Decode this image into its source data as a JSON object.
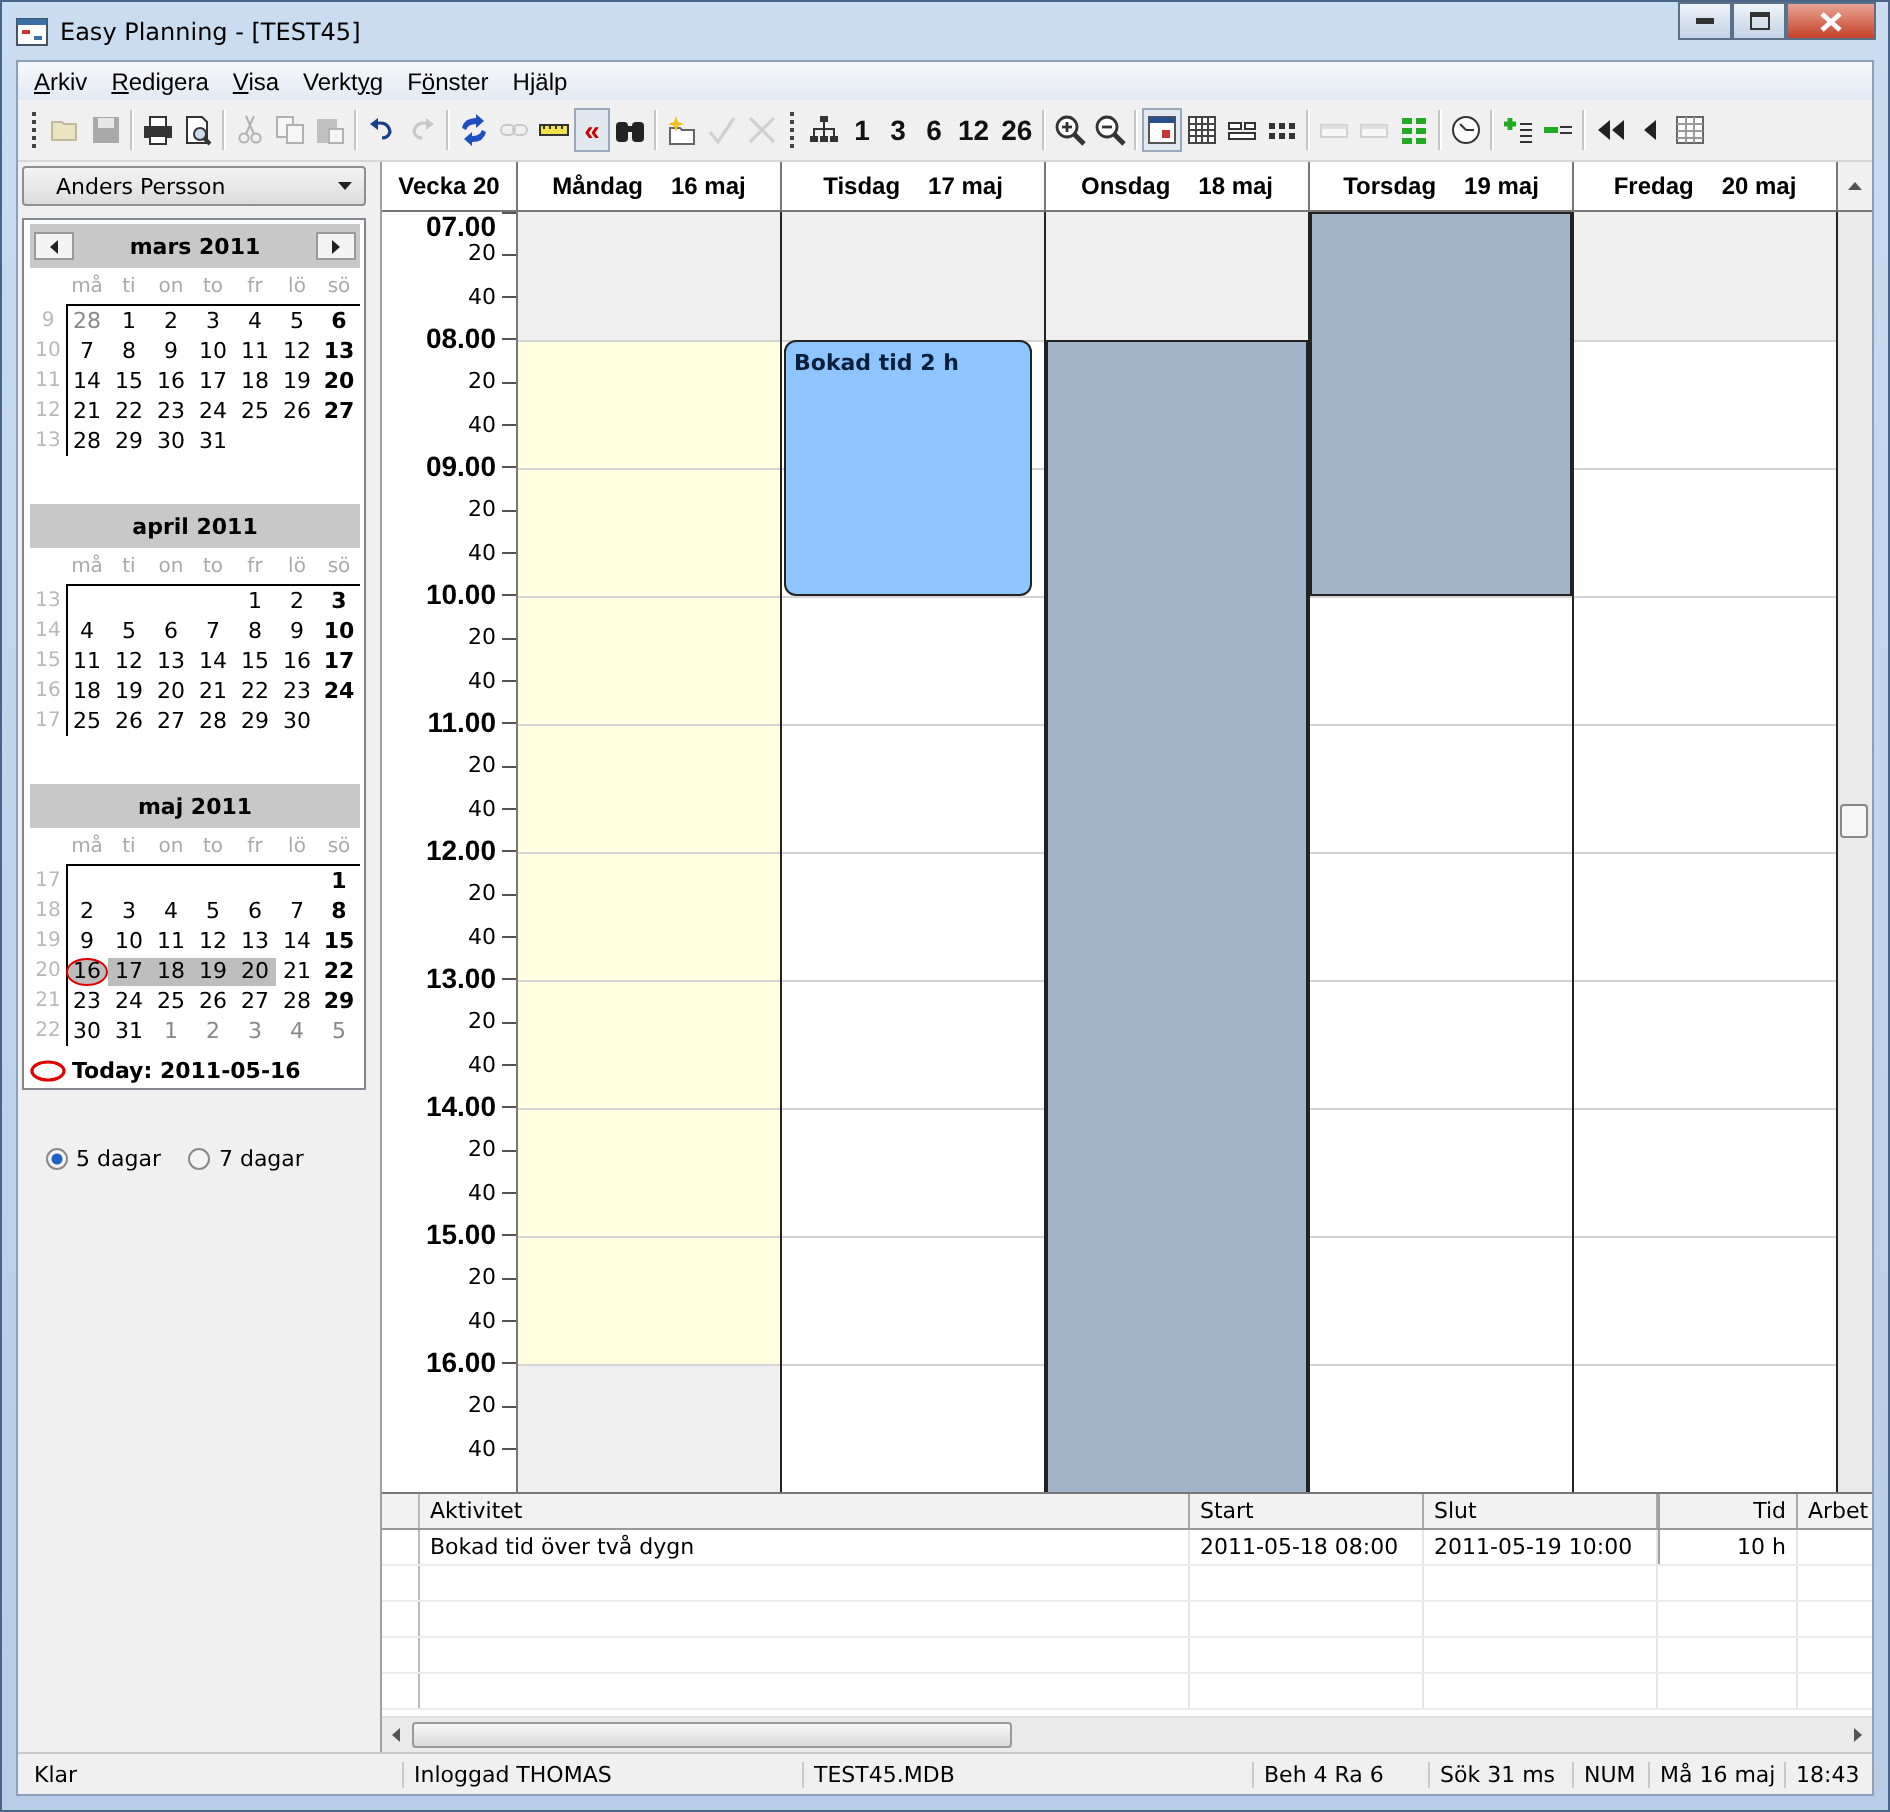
{
  "window": {
    "title": "Easy Planning - [TEST45]"
  },
  "menu": [
    {
      "key": "A",
      "post": "rkiv"
    },
    {
      "key": "R",
      "post": "edigera"
    },
    {
      "key": "V",
      "post": "isa"
    },
    {
      "pre": "Verkt",
      "key": "y",
      "post": "g"
    },
    {
      "pre": "F",
      "key": "ö",
      "post": "nster"
    },
    {
      "pre": "H",
      "key": "j",
      "post": "älp"
    }
  ],
  "toolbar": [
    {
      "kind": "grip"
    },
    {
      "kind": "icon",
      "disabled": true,
      "pressed": false
    },
    {
      "kind": "icon",
      "disabled": true,
      "pressed": false
    },
    {
      "kind": "separator"
    },
    {
      "kind": "icon",
      "disabled": false,
      "pressed": false
    },
    {
      "kind": "icon",
      "disabled": false,
      "pressed": false
    },
    {
      "kind": "separator"
    },
    {
      "kind": "icon",
      "disabled": true,
      "pressed": false
    },
    {
      "kind": "icon",
      "disabled": true,
      "pressed": false
    },
    {
      "kind": "icon",
      "disabled": true,
      "pressed": false
    },
    {
      "kind": "separator"
    },
    {
      "kind": "icon",
      "disabled": false,
      "pressed": false
    },
    {
      "kind": "icon",
      "disabled": true,
      "pressed": false
    },
    {
      "kind": "separator"
    },
    {
      "kind": "icon",
      "disabled": false,
      "pressed": false
    },
    {
      "kind": "icon",
      "disabled": true,
      "pressed": false
    },
    {
      "kind": "icon",
      "disabled": false,
      "pressed": false
    },
    {
      "kind": "text",
      "label": "«",
      "disabled": false,
      "pressed": true
    },
    {
      "kind": "icon",
      "disabled": false,
      "pressed": false
    },
    {
      "kind": "separator"
    },
    {
      "kind": "icon",
      "disabled": false,
      "pressed": false
    },
    {
      "kind": "icon",
      "disabled": true,
      "pressed": false
    },
    {
      "kind": "icon",
      "disabled": true,
      "pressed": false
    },
    {
      "kind": "grip"
    },
    {
      "kind": "icon",
      "disabled": false,
      "pressed": false
    },
    {
      "kind": "text",
      "label": "1",
      "disabled": false,
      "pressed": false
    },
    {
      "kind": "text",
      "label": "3",
      "disabled": false,
      "pressed": false
    },
    {
      "kind": "text",
      "label": "6",
      "disabled": false,
      "pressed": false
    },
    {
      "kind": "text",
      "label": "12",
      "disabled": false,
      "pressed": false
    },
    {
      "kind": "text",
      "label": "26",
      "disabled": false,
      "pressed": false
    },
    {
      "kind": "separator"
    },
    {
      "kind": "icon",
      "disabled": false,
      "pressed": false
    },
    {
      "kind": "icon",
      "disabled": false,
      "pressed": false
    },
    {
      "kind": "separator"
    },
    {
      "kind": "icon",
      "disabled": false,
      "pressed": true
    },
    {
      "kind": "icon",
      "disabled": false,
      "pressed": false
    },
    {
      "kind": "icon",
      "disabled": false,
      "pressed": false
    },
    {
      "kind": "icon",
      "disabled": false,
      "pressed": false
    },
    {
      "kind": "separator"
    },
    {
      "kind": "icon",
      "disabled": true,
      "pressed": false
    },
    {
      "kind": "icon",
      "disabled": true,
      "pressed": false
    },
    {
      "kind": "icon",
      "disabled": false,
      "pressed": false
    },
    {
      "kind": "separator"
    },
    {
      "kind": "icon",
      "disabled": false,
      "pressed": false
    },
    {
      "kind": "separator"
    },
    {
      "kind": "icon",
      "disabled": false,
      "pressed": false
    },
    {
      "kind": "icon",
      "disabled": false,
      "pressed": false
    },
    {
      "kind": "separator"
    },
    {
      "kind": "icon",
      "disabled": false,
      "pressed": false
    },
    {
      "kind": "icon",
      "disabled": false,
      "pressed": false
    },
    {
      "kind": "icon",
      "disabled": false,
      "pressed": false
    }
  ],
  "user_select": {
    "value": "Anders Persson"
  },
  "calendar": {
    "months": [
      {
        "title": "mars 2011",
        "has_nav": true,
        "weekdays": [
          "må",
          "ti",
          "on",
          "to",
          "fr",
          "lö",
          "sö"
        ],
        "weeks": [
          {
            "number": "9",
            "days": [
              {
                "label": "28",
                "muted": true,
                "selected": false,
                "today": false
              },
              {
                "label": "1",
                "muted": false,
                "selected": false,
                "today": false
              },
              {
                "label": "2",
                "muted": false,
                "selected": false,
                "today": false
              },
              {
                "label": "3",
                "muted": false,
                "selected": false,
                "today": false
              },
              {
                "label": "4",
                "muted": false,
                "selected": false,
                "today": false
              },
              {
                "label": "5",
                "muted": false,
                "selected": false,
                "today": false
              },
              {
                "label": "6",
                "muted": false,
                "selected": false,
                "today": false
              }
            ]
          },
          {
            "number": "10",
            "days": [
              {
                "label": "7",
                "muted": false,
                "selected": false,
                "today": false
              },
              {
                "label": "8",
                "muted": false,
                "selected": false,
                "today": false
              },
              {
                "label": "9",
                "muted": false,
                "selected": false,
                "today": false
              },
              {
                "label": "10",
                "muted": false,
                "selected": false,
                "today": false
              },
              {
                "label": "11",
                "muted": false,
                "selected": false,
                "today": false
              },
              {
                "label": "12",
                "muted": false,
                "selected": false,
                "today": false
              },
              {
                "label": "13",
                "muted": false,
                "selected": false,
                "today": false
              }
            ]
          },
          {
            "number": "11",
            "days": [
              {
                "label": "14",
                "muted": false,
                "selected": false,
                "today": false
              },
              {
                "label": "15",
                "muted": false,
                "selected": false,
                "today": false
              },
              {
                "label": "16",
                "muted": false,
                "selected": false,
                "today": false
              },
              {
                "label": "17",
                "muted": false,
                "selected": false,
                "today": false
              },
              {
                "label": "18",
                "muted": false,
                "selected": false,
                "today": false
              },
              {
                "label": "19",
                "muted": false,
                "selected": false,
                "today": false
              },
              {
                "label": "20",
                "muted": false,
                "selected": false,
                "today": false
              }
            ]
          },
          {
            "number": "12",
            "days": [
              {
                "label": "21",
                "muted": false,
                "selected": false,
                "today": false
              },
              {
                "label": "22",
                "muted": false,
                "selected": false,
                "today": false
              },
              {
                "label": "23",
                "muted": false,
                "selected": false,
                "today": false
              },
              {
                "label": "24",
                "muted": false,
                "selected": false,
                "today": false
              },
              {
                "label": "25",
                "muted": false,
                "selected": false,
                "today": false
              },
              {
                "label": "26",
                "muted": false,
                "selected": false,
                "today": false
              },
              {
                "label": "27",
                "muted": false,
                "selected": false,
                "today": false
              }
            ]
          },
          {
            "number": "13",
            "align_end": false,
            "days": [
              {
                "label": "28",
                "muted": false,
                "selected": false,
                "today": false
              },
              {
                "label": "29",
                "muted": false,
                "selected": false,
                "today": false
              },
              {
                "label": "30",
                "muted": false,
                "selected": false,
                "today": false
              },
              {
                "label": "31",
                "muted": false,
                "selected": false,
                "today": false
              }
            ]
          }
        ]
      },
      {
        "title": "april 2011",
        "has_nav": false,
        "weekdays": [
          "må",
          "ti",
          "on",
          "to",
          "fr",
          "lö",
          "sö"
        ],
        "weeks": [
          {
            "number": "13",
            "align_end": true,
            "days": [
              {
                "label": "1",
                "muted": false,
                "selected": false,
                "today": false
              },
              {
                "label": "2",
                "muted": false,
                "selected": false,
                "today": false
              },
              {
                "label": "3",
                "muted": false,
                "selected": false,
                "today": false
              }
            ]
          },
          {
            "number": "14",
            "days": [
              {
                "label": "4",
                "muted": false,
                "selected": false,
                "today": false
              },
              {
                "label": "5",
                "muted": false,
                "selected": false,
                "today": false
              },
              {
                "label": "6",
                "muted": false,
                "selected": false,
                "today": false
              },
              {
                "label": "7",
                "muted": false,
                "selected": false,
                "today": false
              },
              {
                "label": "8",
                "muted": false,
                "selected": false,
                "today": false
              },
              {
                "label": "9",
                "muted": false,
                "selected": false,
                "today": false
              },
              {
                "label": "10",
                "muted": false,
                "selected": false,
                "today": false
              }
            ]
          },
          {
            "number": "15",
            "days": [
              {
                "label": "11",
                "muted": false,
                "selected": false,
                "today": false
              },
              {
                "label": "12",
                "muted": false,
                "selected": false,
                "today": false
              },
              {
                "label": "13",
                "muted": false,
                "selected": false,
                "today": false
              },
              {
                "label": "14",
                "muted": false,
                "selected": false,
                "today": false
              },
              {
                "label": "15",
                "muted": false,
                "selected": false,
                "today": false
              },
              {
                "label": "16",
                "muted": false,
                "selected": false,
                "today": false
              },
              {
                "label": "17",
                "muted": false,
                "selected": false,
                "today": false
              }
            ]
          },
          {
            "number": "16",
            "days": [
              {
                "label": "18",
                "muted": false,
                "selected": false,
                "today": false
              },
              {
                "label": "19",
                "muted": false,
                "selected": false,
                "today": false
              },
              {
                "label": "20",
                "muted": false,
                "selected": false,
                "today": false
              },
              {
                "label": "21",
                "muted": false,
                "selected": false,
                "today": false
              },
              {
                "label": "22",
                "muted": false,
                "selected": false,
                "today": false
              },
              {
                "label": "23",
                "muted": false,
                "selected": false,
                "today": false
              },
              {
                "label": "24",
                "muted": false,
                "selected": false,
                "today": false
              }
            ]
          },
          {
            "number": "17",
            "align_end": false,
            "days": [
              {
                "label": "25",
                "muted": false,
                "selected": false,
                "today": false
              },
              {
                "label": "26",
                "muted": false,
                "selected": false,
                "today": false
              },
              {
                "label": "27",
                "muted": false,
                "selected": false,
                "today": false
              },
              {
                "label": "28",
                "muted": false,
                "selected": false,
                "today": false
              },
              {
                "label": "29",
                "muted": false,
                "selected": false,
                "today": false
              },
              {
                "label": "30",
                "muted": false,
                "selected": false,
                "today": false
              }
            ]
          }
        ]
      },
      {
        "title": "maj 2011",
        "has_nav": false,
        "weekdays": [
          "må",
          "ti",
          "on",
          "to",
          "fr",
          "lö",
          "sö"
        ],
        "weeks": [
          {
            "number": "17",
            "align_end": true,
            "days": [
              {
                "label": "1",
                "muted": false,
                "selected": false,
                "today": false
              }
            ]
          },
          {
            "number": "18",
            "days": [
              {
                "label": "2",
                "muted": false,
                "selected": false,
                "today": false
              },
              {
                "label": "3",
                "muted": false,
                "selected": false,
                "today": false
              },
              {
                "label": "4",
                "muted": false,
                "selected": false,
                "today": false
              },
              {
                "label": "5",
                "muted": false,
                "selected": false,
                "today": false
              },
              {
                "label": "6",
                "muted": false,
                "selected": false,
                "today": false
              },
              {
                "label": "7",
                "muted": false,
                "selected": false,
                "today": false
              },
              {
                "label": "8",
                "muted": false,
                "selected": false,
                "today": false
              }
            ]
          },
          {
            "number": "19",
            "days": [
              {
                "label": "9",
                "muted": false,
                "selected": false,
                "today": false
              },
              {
                "label": "10",
                "muted": false,
                "selected": false,
                "today": false
              },
              {
                "label": "11",
                "muted": false,
                "selected": false,
                "today": false
              },
              {
                "label": "12",
                "muted": false,
                "selected": false,
                "today": false
              },
              {
                "label": "13",
                "muted": false,
                "selected": false,
                "today": false
              },
              {
                "label": "14",
                "muted": false,
                "selected": false,
                "today": false
              },
              {
                "label": "15",
                "muted": false,
                "selected": false,
                "today": false
              }
            ]
          },
          {
            "number": "20",
            "days": [
              {
                "label": "16",
                "muted": false,
                "selected": true,
                "today": true
              },
              {
                "label": "17",
                "muted": false,
                "selected": true,
                "today": false
              },
              {
                "label": "18",
                "muted": false,
                "selected": true,
                "today": false
              },
              {
                "label": "19",
                "muted": false,
                "selected": true,
                "today": false
              },
              {
                "label": "20",
                "muted": false,
                "selected": true,
                "today": false
              },
              {
                "label": "21",
                "muted": false,
                "selected": false,
                "today": false
              },
              {
                "label": "22",
                "muted": false,
                "selected": false,
                "today": false
              }
            ]
          },
          {
            "number": "21",
            "days": [
              {
                "label": "23",
                "muted": false,
                "selected": false,
                "today": false
              },
              {
                "label": "24",
                "muted": false,
                "selected": false,
                "today": false
              },
              {
                "label": "25",
                "muted": false,
                "selected": false,
                "today": false
              },
              {
                "label": "26",
                "muted": false,
                "selected": false,
                "today": false
              },
              {
                "label": "27",
                "muted": false,
                "selected": false,
                "today": false
              },
              {
                "label": "28",
                "muted": false,
                "selected": false,
                "today": false
              },
              {
                "label": "29",
                "muted": false,
                "selected": false,
                "today": false
              }
            ]
          },
          {
            "number": "22",
            "days": [
              {
                "label": "30",
                "muted": false,
                "selected": false,
                "today": false
              },
              {
                "label": "31",
                "muted": false,
                "selected": false,
                "today": false
              },
              {
                "label": "1",
                "muted": true,
                "selected": false,
                "today": false
              },
              {
                "label": "2",
                "muted": true,
                "selected": false,
                "today": false
              },
              {
                "label": "3",
                "muted": true,
                "selected": false,
                "today": false
              },
              {
                "label": "4",
                "muted": true,
                "selected": false,
                "today": false
              },
              {
                "label": "5",
                "muted": true,
                "selected": false,
                "today": false
              }
            ]
          }
        ]
      }
    ],
    "today_label": "Today: 2011-05-16"
  },
  "view_options": [
    {
      "label": "5 dagar",
      "selected": true
    },
    {
      "label": "7 dagar",
      "selected": false
    }
  ],
  "schedule": {
    "week_label": "Vecka 20",
    "days": [
      {
        "weekday": "Måndag",
        "date": "16 maj",
        "shading": [
          {
            "kind": "closed"
          },
          {
            "kind": "workday"
          },
          {
            "kind": "closed"
          }
        ]
      },
      {
        "weekday": "Tisdag",
        "date": "17 maj",
        "shading": [
          {
            "kind": "closed"
          }
        ],
        "events": [
          {
            "title": "Bokad tid 2 h",
            "color": "#8ec5ff"
          }
        ]
      },
      {
        "weekday": "Onsdag",
        "date": "18 maj",
        "shading": [
          {
            "kind": "closed"
          }
        ],
        "events": [
          {
            "color": "#a1b4ca"
          }
        ]
      },
      {
        "weekday": "Torsdag",
        "date": "19 maj",
        "events": [
          {
            "color": "#a1b4ca"
          }
        ]
      },
      {
        "weekday": "Fredag",
        "date": "20 maj",
        "shading": [
          {
            "kind": "closed"
          }
        ]
      }
    ],
    "time_labels": [
      {
        "kind": "hour",
        "label": "07.00"
      },
      {
        "kind": "minute",
        "label": "20"
      },
      {
        "kind": "minute",
        "label": "40"
      },
      {
        "kind": "hour",
        "label": "08.00"
      },
      {
        "kind": "minute",
        "label": "20"
      },
      {
        "kind": "minute",
        "label": "40"
      },
      {
        "kind": "hour",
        "label": "09.00"
      },
      {
        "kind": "minute",
        "label": "20"
      },
      {
        "kind": "minute",
        "label": "40"
      },
      {
        "kind": "hour",
        "label": "10.00"
      },
      {
        "kind": "minute",
        "label": "20"
      },
      {
        "kind": "minute",
        "label": "40"
      },
      {
        "kind": "hour",
        "label": "11.00"
      },
      {
        "kind": "minute",
        "label": "20"
      },
      {
        "kind": "minute",
        "label": "40"
      },
      {
        "kind": "hour",
        "label": "12.00"
      },
      {
        "kind": "minute",
        "label": "20"
      },
      {
        "kind": "minute",
        "label": "40"
      },
      {
        "kind": "hour",
        "label": "13.00"
      },
      {
        "kind": "minute",
        "label": "20"
      },
      {
        "kind": "minute",
        "label": "40"
      },
      {
        "kind": "hour",
        "label": "14.00"
      },
      {
        "kind": "minute",
        "label": "20"
      },
      {
        "kind": "minute",
        "label": "40"
      },
      {
        "kind": "hour",
        "label": "15.00"
      },
      {
        "kind": "minute",
        "label": "20"
      },
      {
        "kind": "minute",
        "label": "40"
      },
      {
        "kind": "hour",
        "label": "16.00"
      },
      {
        "kind": "minute",
        "label": "20"
      },
      {
        "kind": "minute",
        "label": "40"
      }
    ]
  },
  "activity_table": {
    "columns": [
      {
        "label": "Aktivitet"
      },
      {
        "label": "Start"
      },
      {
        "label": "Slut"
      },
      {
        "label": "Tid"
      },
      {
        "label": "Arbet"
      }
    ],
    "rows": [
      [
        "Bokad tid över två dygn",
        "2011-05-18 08:00",
        "2011-05-19 10:00",
        "10 h"
      ]
    ]
  },
  "status_bar": [
    "Klar",
    "Inloggad THOMAS",
    "TEST45.MDB",
    "Beh 4  Ra 6",
    "Sök 31 ms",
    "NUM",
    "Må 16 maj",
    "18:43"
  ]
}
